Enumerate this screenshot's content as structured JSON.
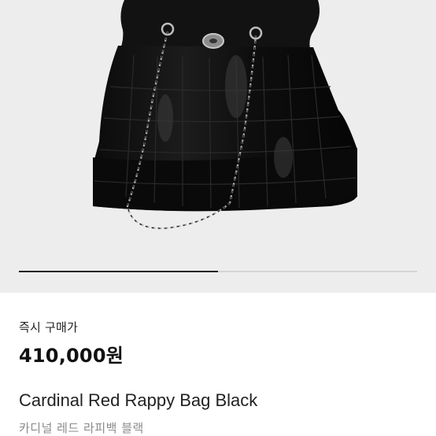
{
  "gallery": {
    "progress": 0.5
  },
  "product": {
    "buy_label": "즉시 구매가",
    "price": "410,000원",
    "name_en": "Cardinal Red Rappy Bag Black",
    "name_ko": "카디널 레드 라피백 블랙"
  },
  "icons": {
    "photo": "bag-photo"
  }
}
